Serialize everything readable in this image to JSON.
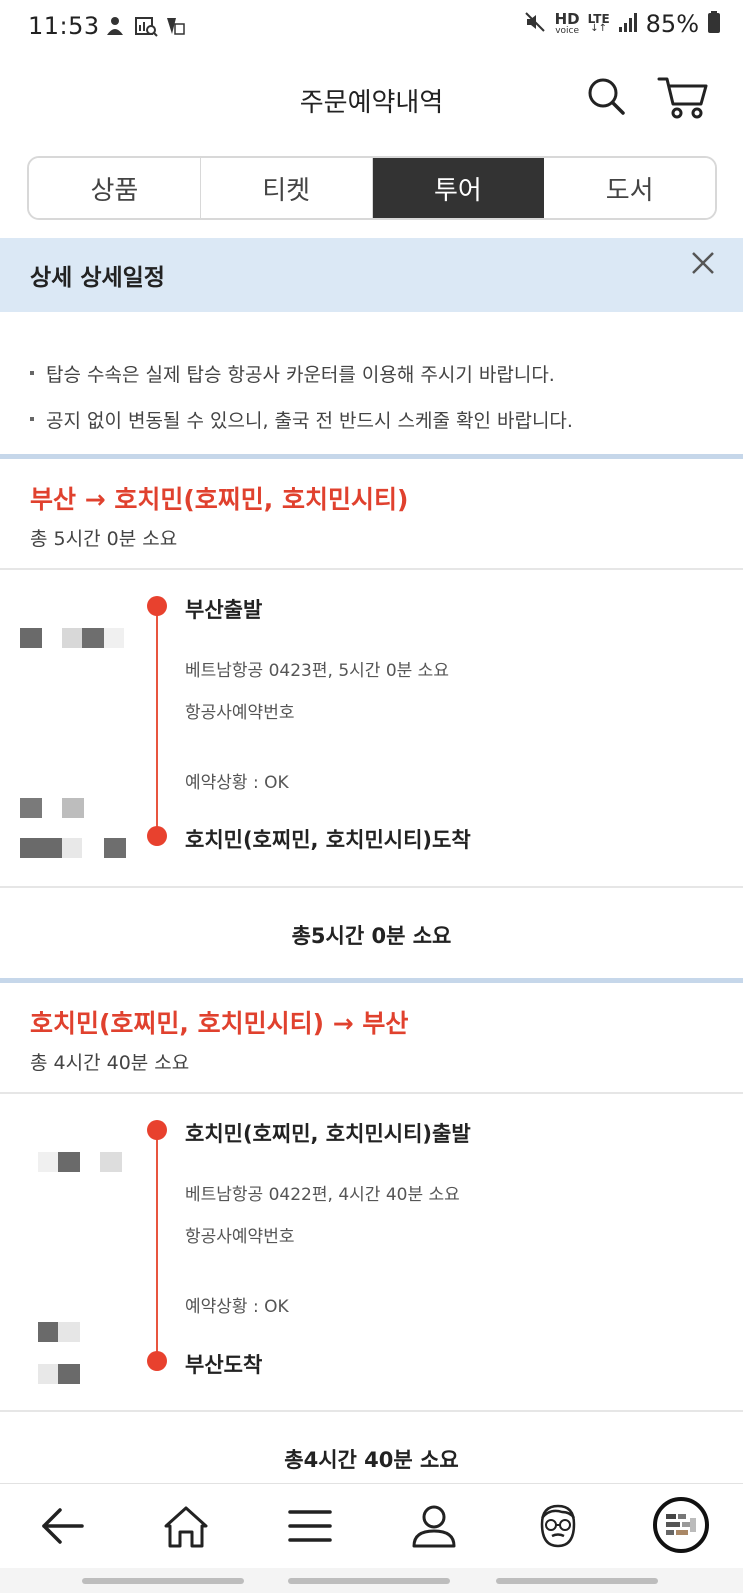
{
  "status_bar": {
    "time": "11:53",
    "battery": "85%",
    "hd": "HD",
    "voice": "voice",
    "lte": "LTE"
  },
  "header": {
    "title": "주문예약내역"
  },
  "tabs": [
    {
      "label": "상품",
      "active": false
    },
    {
      "label": "티켓",
      "active": false
    },
    {
      "label": "투어",
      "active": true
    },
    {
      "label": "도서",
      "active": false
    }
  ],
  "detail": {
    "title": "상세 상세일정"
  },
  "notices": [
    "탑승 수속은 실제 탑승 항공사 카운터를 이용해 주시기 바랍니다.",
    "공지 없이 변동될 수 있으니, 출국 전 반드시 스케줄 확인 바랍니다."
  ],
  "segments": [
    {
      "route": "부산 → 호치민(호찌민, 호치민시티)",
      "duration": "총 5시간 0분 소요",
      "departure": "부산출발",
      "flight": "베트남항공 0423편, 5시간 0분 소요",
      "booking_no_label": "항공사예약번호",
      "status": "예약상황 : OK",
      "arrival": "호치민(호찌민, 호치민시티)도착",
      "total": "총5시간 0분 소요"
    },
    {
      "route": "호치민(호찌민, 호치민시티) → 부산",
      "duration": "총 4시간 40분 소요",
      "departure": "호치민(호찌민, 호치민시티)출발",
      "flight": "베트남항공 0422편, 4시간 40분 소요",
      "booking_no_label": "항공사예약번호",
      "status": "예약상황 : OK",
      "arrival": "부산도착",
      "total": "총4시간 40분 소요"
    }
  ],
  "colors": {
    "accent_red": "#e0412e",
    "detail_bar_bg": "#dbe8f5",
    "active_tab_bg": "#333333"
  },
  "bottom_nav": [
    "back-arrow-icon",
    "home-icon",
    "menu-icon",
    "user-icon",
    "face-icon",
    "profile-avatar-icon"
  ]
}
